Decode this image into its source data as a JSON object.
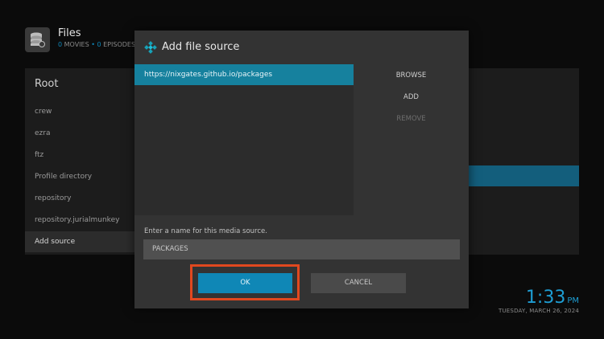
{
  "header": {
    "title": "Files",
    "movies_count": "0",
    "movies_label": "MOVIES",
    "separator": "•",
    "episodes_count": "0",
    "episodes_label": "EPISODES"
  },
  "sidebar": {
    "title": "Root",
    "items": [
      {
        "label": "crew"
      },
      {
        "label": "ezra"
      },
      {
        "label": "ftz"
      },
      {
        "label": "Profile directory"
      },
      {
        "label": "repository"
      },
      {
        "label": "repository.jurialmunkey"
      },
      {
        "label": "Add source"
      }
    ]
  },
  "dialog": {
    "title": "Add file source",
    "source_path": "https://nixgates.github.io/packages",
    "actions": {
      "browse": "BROWSE",
      "add": "ADD",
      "remove": "REMOVE"
    },
    "name_label": "Enter a name for this media source.",
    "name_value": "PACKAGES",
    "ok_label": "OK",
    "cancel_label": "CANCEL"
  },
  "clock": {
    "time": "1:33",
    "ampm": "PM",
    "date": "TUESDAY, MARCH 26, 2024"
  },
  "colors": {
    "accent": "#0f87b6",
    "highlight_ring": "#e1481f",
    "dialog_bg": "#333333"
  },
  "icons": {
    "app": "hard-drive-stack-icon",
    "dialog": "kodi-logo-icon"
  }
}
